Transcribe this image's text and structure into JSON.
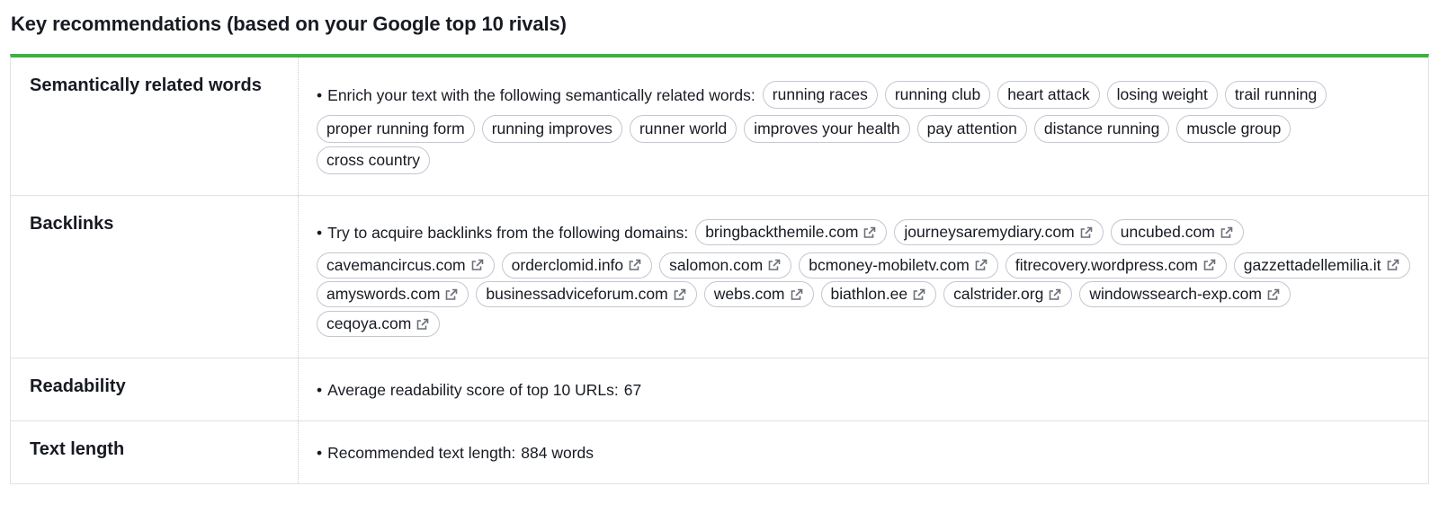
{
  "title": "Key recommendations (based on your Google top 10 rivals)",
  "colors": {
    "accent": "#3cb33c",
    "border": "#e0e1e9",
    "chip_border": "#c5c7d0"
  },
  "rows": {
    "semantic": {
      "label": "Semantically related words",
      "lead": "Enrich your text with the following semantically related words:",
      "chips": [
        "running races",
        "running club",
        "heart attack",
        "losing weight",
        "trail running",
        "proper running form",
        "running improves",
        "runner world",
        "improves your health",
        "pay attention",
        "distance running",
        "muscle group",
        "cross country"
      ]
    },
    "backlinks": {
      "label": "Backlinks",
      "lead": "Try to acquire backlinks from the following domains:",
      "chip_icon": "external-link-icon",
      "chips": [
        "bringbackthemile.com",
        "journeysaremydiary.com",
        "uncubed.com",
        "cavemancircus.com",
        "orderclomid.info",
        "salomon.com",
        "bcmoney-mobiletv.com",
        "fitrecovery.wordpress.com",
        "gazzettadellemilia.it",
        "amyswords.com",
        "businessadviceforum.com",
        "webs.com",
        "biathlon.ee",
        "calstrider.org",
        "windowssearch-exp.com",
        "ceqoya.com"
      ]
    },
    "readability": {
      "label": "Readability",
      "lead": "Average readability score of top 10 URLs:",
      "value": "67"
    },
    "text_length": {
      "label": "Text length",
      "lead": "Recommended text length:",
      "value": "884 words"
    }
  }
}
